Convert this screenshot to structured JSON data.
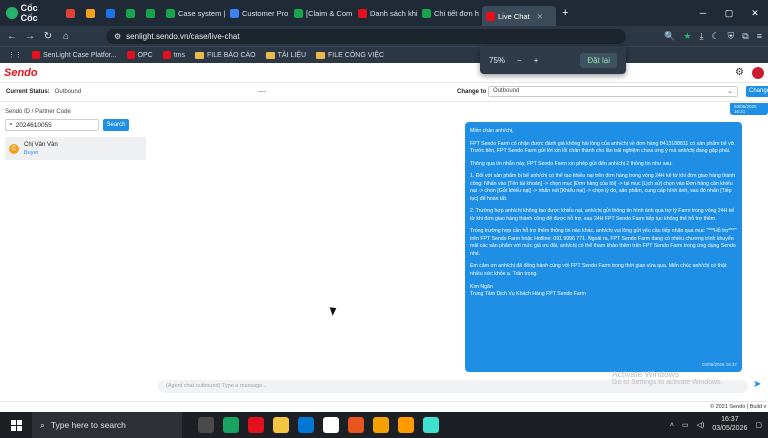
{
  "browser": {
    "brand": "Cốc Cốc",
    "tabs": [
      {
        "label": "",
        "color": "#e34133"
      },
      {
        "label": "",
        "color": "#f2a31b"
      },
      {
        "label": "",
        "color": "#1a73e8"
      },
      {
        "label": "",
        "color": "#17a34a"
      },
      {
        "label": "",
        "color": "#17a34a"
      },
      {
        "label": "Case system |",
        "color": "#17a34a"
      },
      {
        "label": "Customer Pro",
        "color": "#3b82f6"
      },
      {
        "label": "[Claim & Com",
        "color": "#17a34a"
      },
      {
        "label": "Danh sách khi",
        "color": "#e5101d"
      },
      {
        "label": "Chi tiết đơn h",
        "color": "#17a34a"
      },
      {
        "label": "Live Chat",
        "color": "#e5101d",
        "active": true
      }
    ],
    "url": "senlight.sendo.vn/case/live-chat",
    "bookmarks": [
      {
        "label": "SenLight Case Platfor...",
        "type": "site",
        "color": "#e5101d"
      },
      {
        "label": "OPC",
        "type": "site",
        "color": "#e5101d"
      },
      {
        "label": "tms",
        "type": "site",
        "color": "#e5101d"
      },
      {
        "label": "FILE BÁO CÁO",
        "type": "folder"
      },
      {
        "label": "TÀI LIỆU",
        "type": "folder"
      },
      {
        "label": "FILE CÔNG VIỆC",
        "type": "folder"
      }
    ],
    "zoom": {
      "value": "75%",
      "reset_label": "Đặt lại"
    }
  },
  "sendo": {
    "logo": "Sendo",
    "status_label": "Current Status:",
    "status_value": "Outbound",
    "status_dash": "----",
    "change_to_label": "Change to",
    "change_to_value": "Outbound",
    "change_button": "Change",
    "search_label": "Sendo ID / Partner Code",
    "search_value": "2024610055",
    "search_button": "Search",
    "contact": {
      "initial": "C",
      "name": "Chị Vân Vân",
      "tag": "Buyer"
    },
    "prev_time": "03/05/2026 16:21",
    "message": {
      "paragraphs": [
        "Miền chào anh/chị,",
        "FPT Sendo Farm có nhận được đánh giá không hài lòng của anh/chị về đơn hàng 8413188811 có sản phẩm bể vỡ. Trước tiên, FPT Sendo Farm gửi lời xin lỗi chân thành cho lần trải nghiệm chưa ưng ý mà anh/chị đang gặp phải.",
        "Thông qua tin nhắn này, FPT Sendo Farm xin phép gửi đến anh/chị 2 thông tin như sau:",
        "1. Đối với sản phẩm bị bể anh/chị có thể tạo khiếu nại trên đơn hàng trong vòng 24H kể từ khi đơn giao hàng thành công: Nhấn vào [Tên tài khoản] -> chọn mục [Đơn hàng của tôi] -> tại mục [Lịch sử] chọn vào Đơn hàng cần khiếu nại -> chọn [Gửi khiếu nại] -> nhấn nút [Khiếu nại] -> chọn lý do, sản phẩm, cung cấp hình ảnh, sau đó nhấn [Tiếp tục] để hoàn tất.",
        "2. Trường hợp anh/chị không tạo được khiếu nại, anh/chị gửi thông tin hình ảnh qua trợ lý Farm trong vòng 24H kể từ khi đơn giao hàng thành công để được hỗ trợ, sau 24H FPT Sendo Farm tiếp tục không thể hỗ trợ thêm.",
        "Trong trường hợp cần hỗ trợ thêm thông tin nào khác, anh/chị vui lòng gửi yêu cầu tiếp nhận qua mục \"***Hỗ trợ***\" trên FPT Sendo Farm hoặc Hotline: 091 9996 771. Ngoài ra, FPT Sendo Farm đang có nhiều chương trình khuyến mãi các sản phẩm với mức giá ưu đãi, anh/chị có thể tham khảo thêm trên FPT Sendo Farm trong ứng dụng Sendo nhé.",
        "Em cảm ơn anh/chị đã đồng hành cùng với FPT Sendo Farm trong thời gian vừa qua. Mến chúc anh/chị có thật nhiều sức khỏe ạ. Trân trọng.",
        "Kim Ngân",
        "Trung Tâm Dịch Vụ Khách Hàng FPT Sendo Farm"
      ],
      "time": "03/05/2026 16:37"
    },
    "input_placeholder": "(Agent chat outbound) Type a message...",
    "footer": "© 2021 Sendo | Build v"
  },
  "windows": {
    "activate_title": "Activate Windows",
    "activate_sub": "Go to Settings to activate Windows.",
    "search_placeholder": "Type here to search",
    "time": "16:37",
    "date": "03/05/2026",
    "taskbar_apps": [
      "#4a4a4a",
      "#1aa260",
      "#e5101d",
      "#f4c542",
      "#0078d4",
      "#ffffff",
      "#e8551e",
      "#f4a000",
      "#ff9a00",
      "#40e0d0"
    ]
  }
}
